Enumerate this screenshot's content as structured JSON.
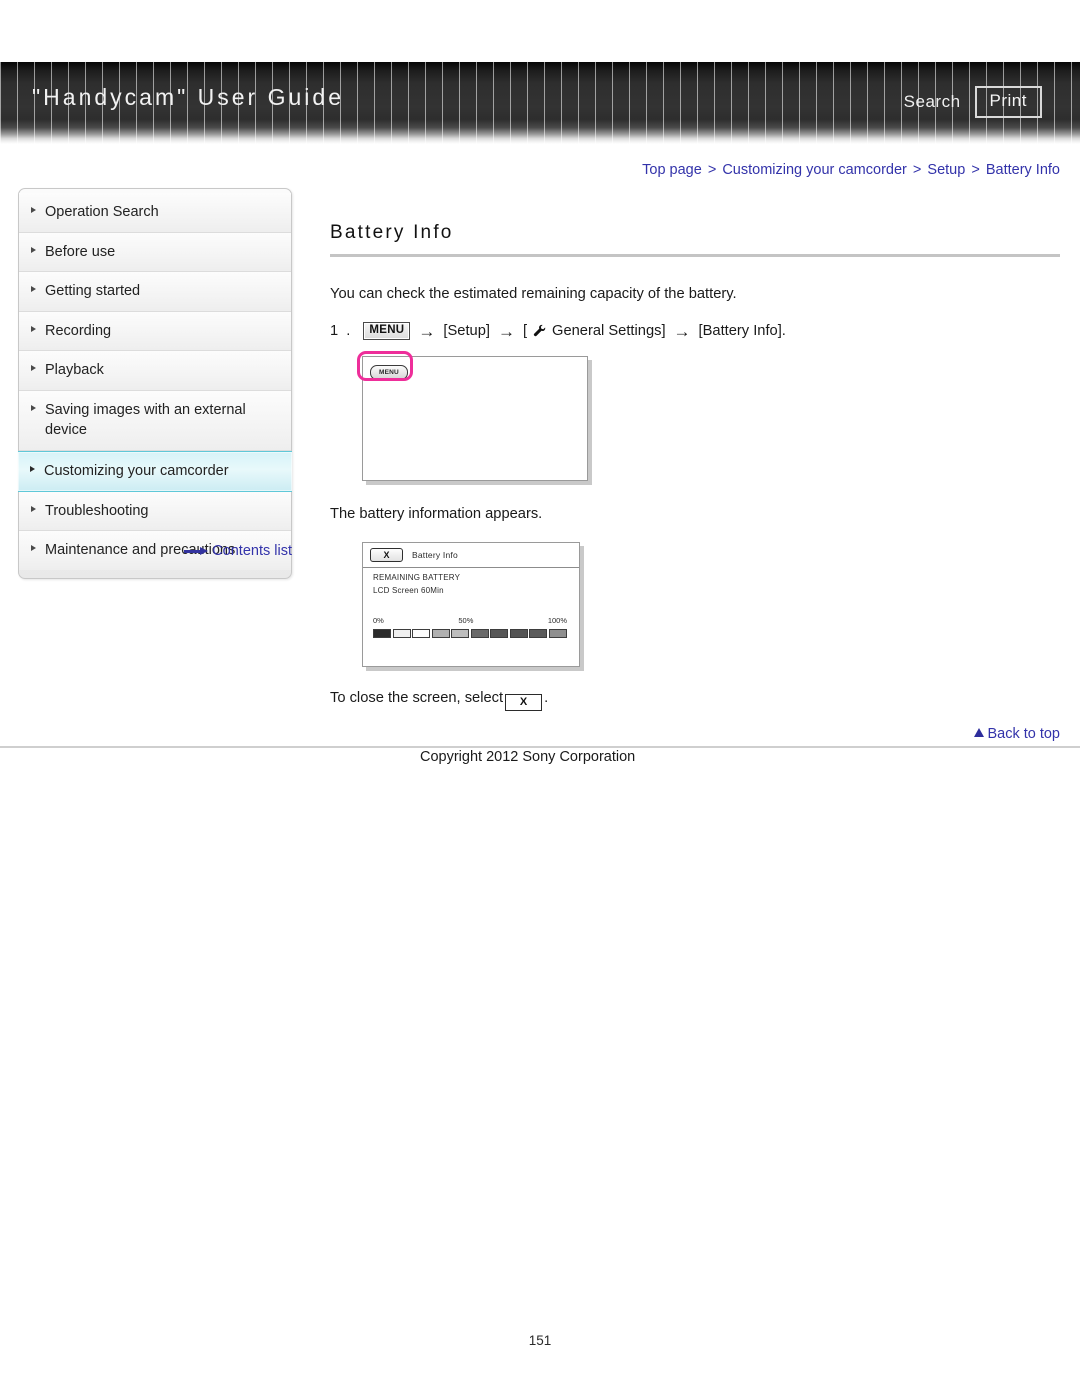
{
  "header": {
    "title": "\"Handycam\" User Guide",
    "search_label": "Search",
    "print_label": "Print"
  },
  "breadcrumb": {
    "items": [
      "Top page",
      "Customizing your camcorder",
      "Setup",
      "Battery Info"
    ],
    "separator": ">"
  },
  "sidebar": {
    "items": [
      {
        "label": "Operation Search",
        "active": false
      },
      {
        "label": "Before use",
        "active": false
      },
      {
        "label": "Getting started",
        "active": false
      },
      {
        "label": "Recording",
        "active": false
      },
      {
        "label": "Playback",
        "active": false
      },
      {
        "label": "Saving images with an external device",
        "active": false
      },
      {
        "label": "Customizing your camcorder",
        "active": true
      },
      {
        "label": "Troubleshooting",
        "active": false
      },
      {
        "label": "Maintenance and precautions",
        "active": false
      }
    ],
    "contents_link": "Contents list"
  },
  "main": {
    "page_title": "Battery Info",
    "intro": "You can check the estimated remaining capacity of the battery.",
    "step1": {
      "number": "1 .",
      "menu_chip": "MENU",
      "arrow": "→",
      "part_setup": "[Setup]",
      "bracket_open": "[",
      "part_general": "General Settings]",
      "part_battery": "[Battery Info]."
    },
    "after_step_text": "The battery information appears.",
    "close_text_before": "To close the screen, select",
    "close_button_label": "X",
    "close_text_after": ".",
    "lcd_blank": {
      "menu_button_label": "MENU"
    },
    "lcd_battery": {
      "close_label": "X",
      "title": "Battery Info",
      "line1": "REMAINING BATTERY",
      "line2": "LCD Screen 60Min",
      "scale_min": "0%",
      "scale_mid": "50%",
      "scale_max": "100%",
      "segment_fills": [
        "#2b2b2b",
        "#f0f0f0",
        "#fdfdfd",
        "#b0b0b0",
        "#bdbdbd",
        "#6a6a6a",
        "#575757",
        "#545454",
        "#5c5c5c",
        "#8f8f8f"
      ]
    }
  },
  "footer": {
    "back_to_top": "Back to top",
    "copyright": "Copyright 2012 Sony Corporation",
    "page_number": "151"
  },
  "colors": {
    "link": "#3333aa",
    "accent_highlight": "#5fc8d8",
    "magenta_callout": "#ee2e9a",
    "header_dark": "#2e2e2e"
  }
}
